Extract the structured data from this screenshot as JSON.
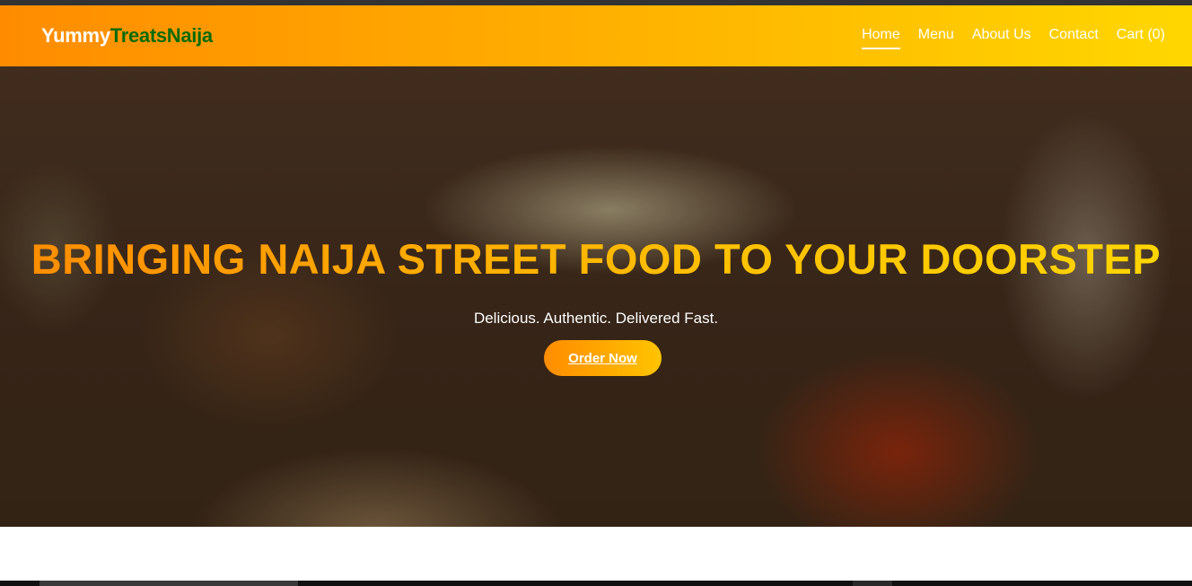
{
  "brand": {
    "part1": "Yummy",
    "part2": "TreatsNaija"
  },
  "nav": {
    "items": [
      {
        "label": "Home",
        "active": true
      },
      {
        "label": "Menu",
        "active": false
      },
      {
        "label": "About Us",
        "active": false
      },
      {
        "label": "Contact",
        "active": false
      },
      {
        "label": "Cart (0)",
        "active": false
      }
    ]
  },
  "hero": {
    "title": "BRINGING NAIJA STREET FOOD TO YOUR DOORSTEP",
    "subtitle": "Delicious. Authentic. Delivered Fast.",
    "cta_label": "Order Now"
  },
  "colors": {
    "accent_orange": "#ff8c00",
    "accent_yellow": "#ffd700",
    "brand_green": "#0a6b0a"
  }
}
